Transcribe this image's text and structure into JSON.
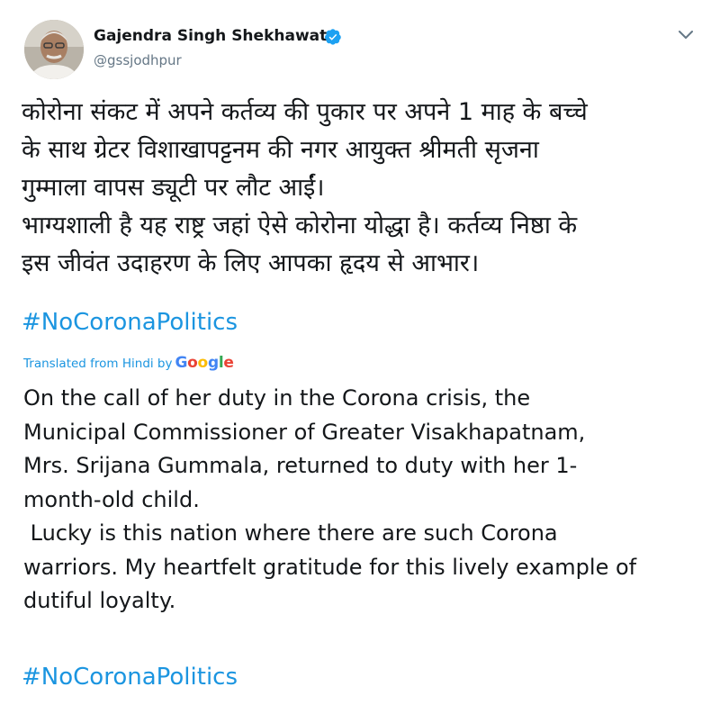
{
  "author": {
    "name": "Gajendra Singh Shekhawat",
    "handle": "@gssjodhpur",
    "verified": true
  },
  "tweet": {
    "hindi_lines": [
      "कोरोना संकट में अपने कर्तव्य की पुकार पर अपने 1 माह के बच्चे",
      "के साथ ग्रेटर विशाखापट्टनम की नगर आयुक्त श्रीमती सृजना",
      "गुम्माला वापस ड्यूटी पर लौट आईं।",
      "भाग्यशाली है यह राष्ट्र जहां ऐसे कोरोना योद्धा है। कर्तव्य निष्ठा के",
      "इस जीवंत उदाहरण के लिए आपका हृदय से आभार।"
    ],
    "hashtag_hindi": "#NoCoronaPolitics",
    "translation_label": "Translated from Hindi by",
    "translation_brand": "Google",
    "english_lines": [
      "On the call of her duty in the Corona crisis, the",
      "Municipal Commissioner of Greater Visakhapatnam,",
      "Mrs. Srijana Gummala, returned to duty with her 1-",
      "month-old child.",
      " Lucky is this nation where there are such Corona",
      "warriors. My heartfelt gratitude for this lively example of",
      "dutiful loyalty."
    ],
    "hashtag_english": "#NoCoronaPolitics"
  },
  "icons": {
    "verified": "verified-badge-icon",
    "menu": "chevron-down-icon"
  },
  "colors": {
    "link": "#1b95e0",
    "text": "#14171a",
    "secondary": "#657786",
    "verified": "#1da1f2"
  }
}
